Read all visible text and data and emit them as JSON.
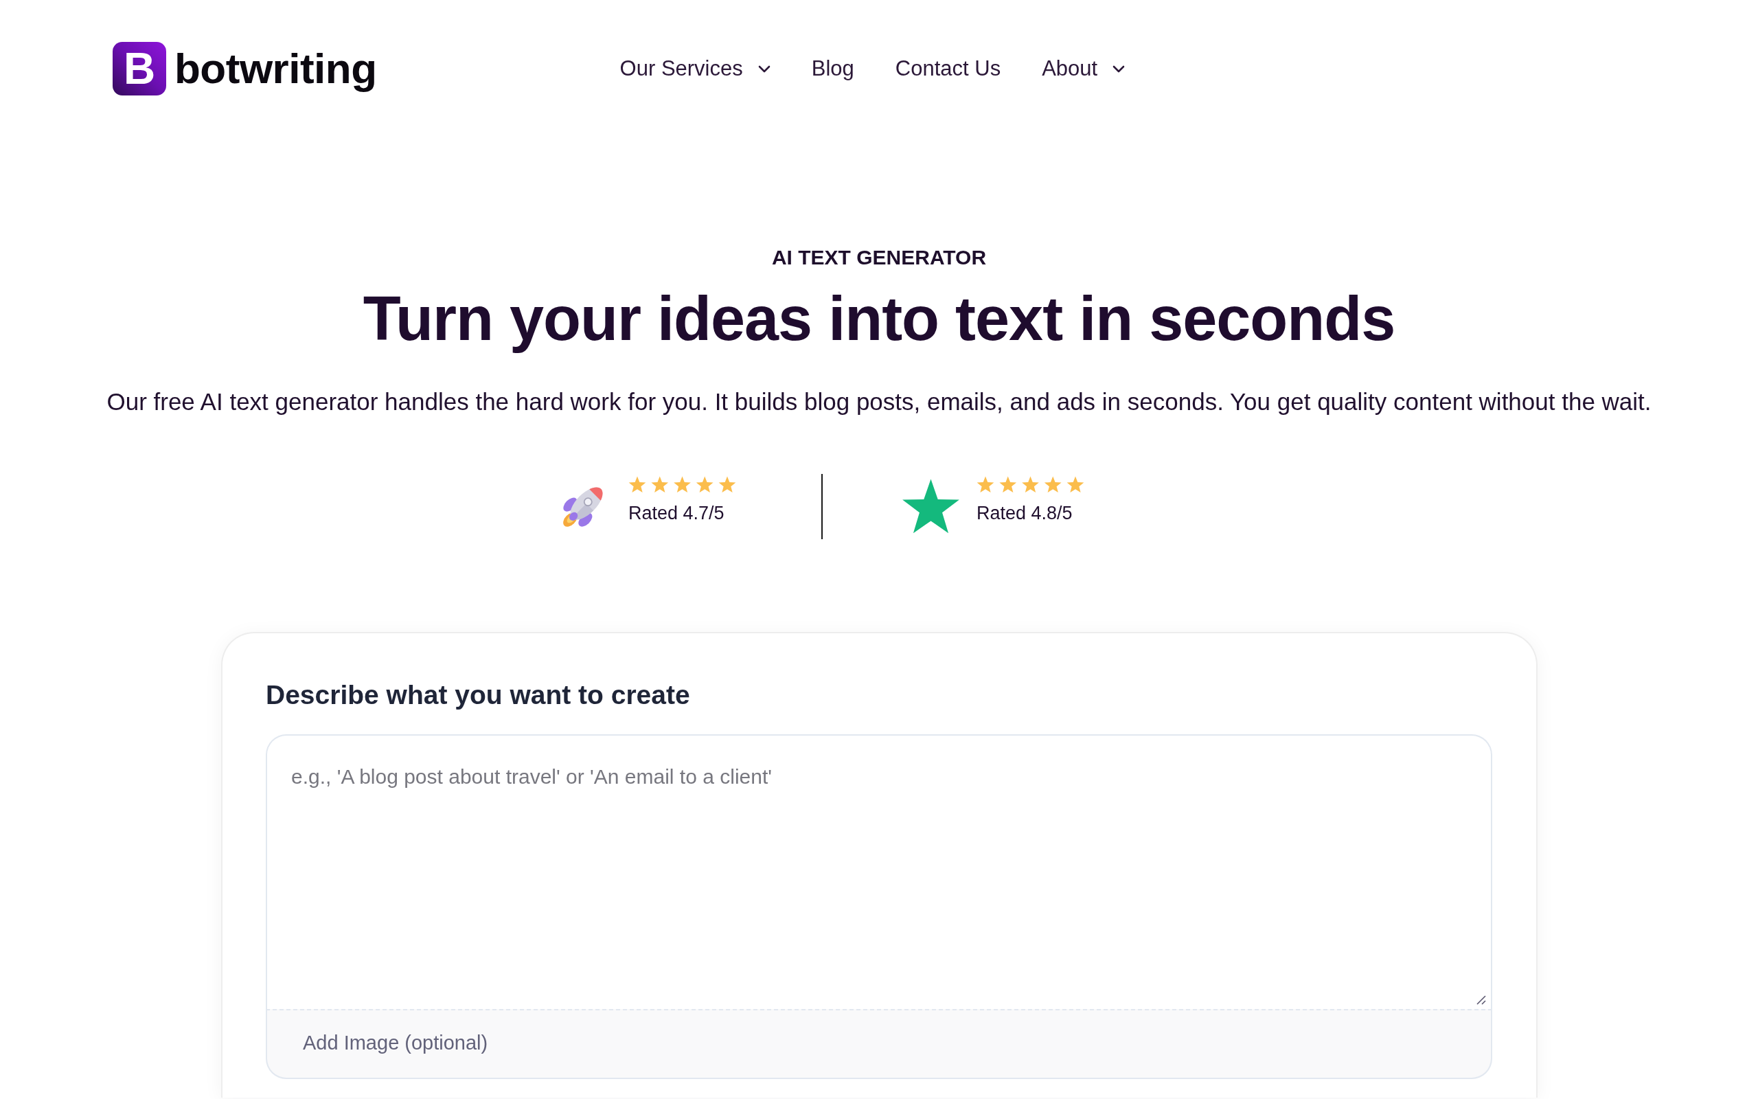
{
  "header": {
    "logo": {
      "mark": "B",
      "name": "botwriting"
    },
    "nav": [
      {
        "label": "Our Services",
        "has_menu": true
      },
      {
        "label": "Blog",
        "has_menu": false
      },
      {
        "label": "Contact Us",
        "has_menu": false
      },
      {
        "label": "About",
        "has_menu": true
      }
    ]
  },
  "hero": {
    "eyebrow": "AI TEXT GENERATOR",
    "title": "Turn your ideas into text in seconds",
    "subtitle": "Our free AI text generator handles the hard work for you. It builds blog posts, emails, and ads in seconds. You get quality content without the wait."
  },
  "ratings": [
    {
      "kind": "rocket",
      "stars": 5,
      "label": "Rated 4.7/5"
    },
    {
      "kind": "star",
      "stars": 5,
      "label": "Rated 4.8/5"
    }
  ],
  "generator": {
    "title": "Describe what you want to create",
    "prompt": {
      "placeholder": "e.g., 'A blog post about travel' or 'An email to a client'"
    },
    "image_upload": {
      "label": "Add Image (optional)"
    }
  }
}
